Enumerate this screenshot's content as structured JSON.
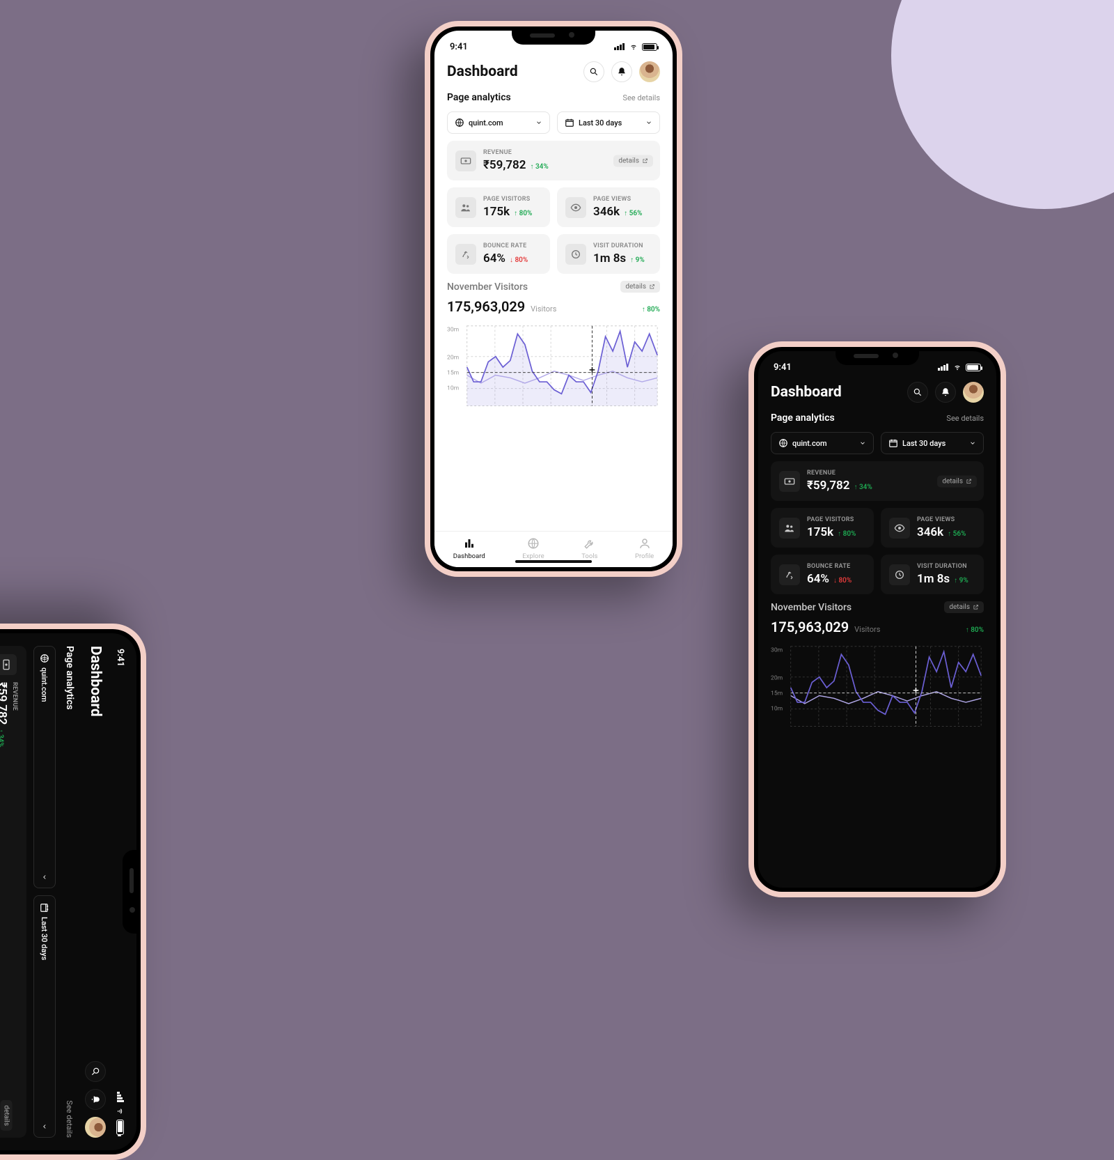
{
  "status": {
    "time": "9:41"
  },
  "header": {
    "title": "Dashboard"
  },
  "analytics": {
    "section_label": "Page analytics",
    "see_details": "See details",
    "site": "quint.com",
    "range": "Last 30 days"
  },
  "metrics": {
    "revenue": {
      "label": "REVENUE",
      "value": "₹59,782",
      "delta": "34%",
      "dir": "up"
    },
    "visitors": {
      "label": "PAGE VISITORS",
      "value": "175k",
      "delta": "80%",
      "dir": "up"
    },
    "views": {
      "label": "PAGE VIEWS",
      "value": "346k",
      "delta": "56%",
      "dir": "up"
    },
    "bounce": {
      "label": "BOUNCE RATE",
      "value": "64%",
      "delta": "80%",
      "dir": "down"
    },
    "duration": {
      "label": "VISIT DURATION",
      "value": "1m 8s",
      "delta": "9%",
      "dir": "up"
    },
    "details_chip": "details"
  },
  "visitors_section": {
    "title": "November Visitors",
    "count": "175,963,029",
    "unit": "Visitors",
    "delta": "80%",
    "details_chip": "details"
  },
  "chart_data": {
    "type": "line",
    "xlabel": "",
    "ylabel": "",
    "y_unit": "m",
    "ylim": [
      10,
      30
    ],
    "y_ticks": [
      10,
      15,
      20,
      30
    ],
    "series": [
      {
        "name": "current",
        "values": [
          17,
          14,
          14,
          18,
          20,
          17,
          19,
          27,
          24,
          16,
          14,
          14,
          12,
          11,
          15,
          14,
          14,
          12,
          16,
          26,
          22,
          28,
          17,
          25,
          22,
          27,
          21
        ]
      },
      {
        "name": "previous",
        "values": [
          15,
          13,
          15,
          14,
          16,
          13,
          15,
          14,
          13,
          15,
          14,
          17,
          16,
          15,
          17,
          15,
          14,
          13,
          15,
          14,
          16,
          14,
          15,
          14,
          13,
          15,
          14
        ]
      }
    ],
    "crosshair": {
      "x_index": 18,
      "y": 15
    }
  },
  "tabs": {
    "dashboard": "Dashboard",
    "explore": "Explore",
    "tools": "Tools",
    "profile": "Profile"
  }
}
